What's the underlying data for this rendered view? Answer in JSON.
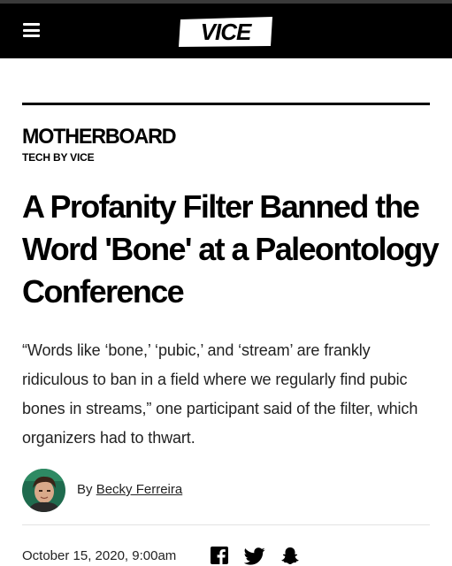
{
  "header": {
    "logo_text": "VICE",
    "menu_icon": "hamburger-menu-icon"
  },
  "section": {
    "title": "MOTHERBOARD",
    "subtitle": "TECH BY VICE"
  },
  "article": {
    "headline": "A Profanity Filter Banned the Word 'Bone' at a Paleontology Conference",
    "dek": "“Words like ‘bone,’ ‘pubic,’ and ‘stream’ are frankly ridiculous to ban in a field where we regularly find pubic bones in streams,” one participant said of the filter, which organizers had to thwart.",
    "byline_prefix": "By",
    "author": "Becky Ferreira",
    "date": "October 15, 2020, 9:00am"
  },
  "share": {
    "icons": [
      "facebook-icon",
      "twitter-icon",
      "snapchat-icon"
    ]
  }
}
